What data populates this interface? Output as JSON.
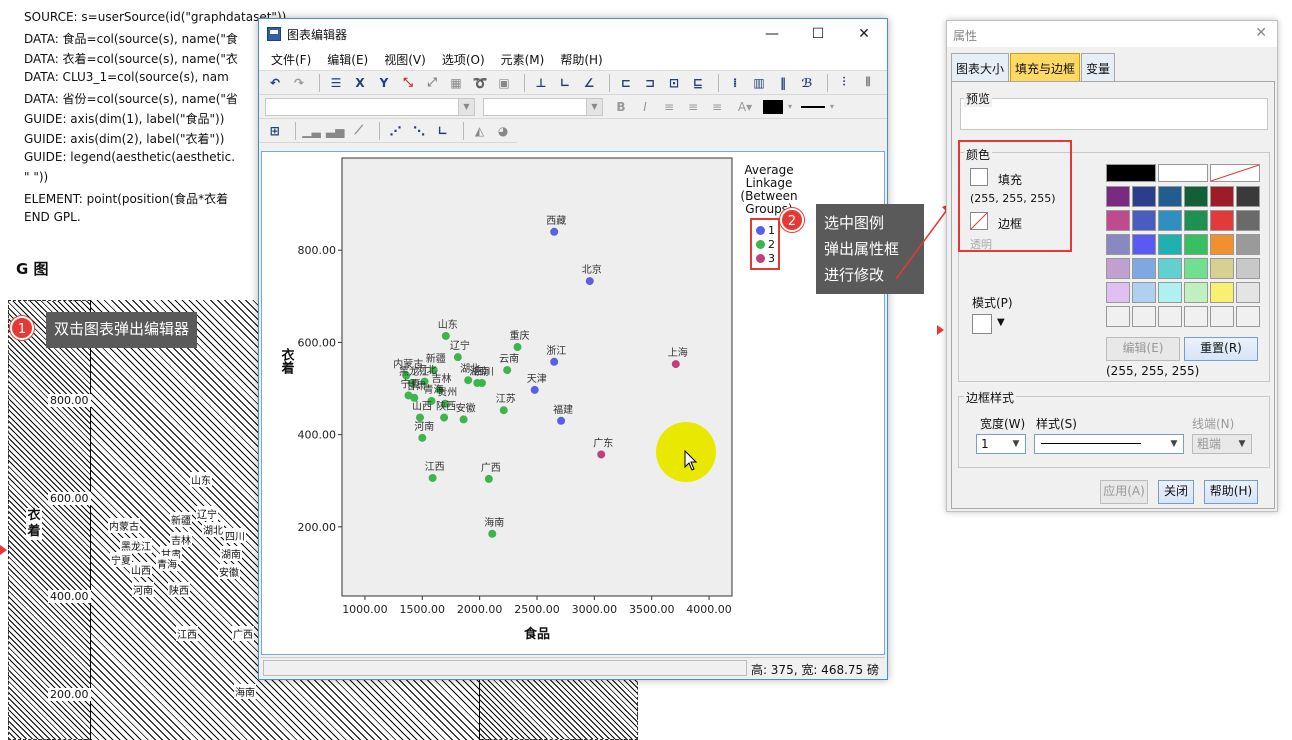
{
  "syntax": {
    "lines": [
      "SOURCE: s=userSource(id(\"graphdataset\"))",
      "DATA: 食品=col(source(s), name(\"食",
      "DATA: 衣着=col(source(s), name(\"衣",
      "DATA: CLU3_1=col(source(s), nam",
      "DATA: 省份=col(source(s), name(\"省",
      "GUIDE: axis(dim(1), label(\"食品\"))",
      "GUIDE: axis(dim(2), label(\"衣着\"))",
      "GUIDE: legend(aesthetic(aesthetic.",
      "  \"  \"))",
      "ELEMENT: point(position(食品*衣着",
      "END GPL."
    ],
    "heading": "G 图",
    "bg_ylabel": "衣着",
    "bg_ticks": [
      "800.00",
      "600.00",
      "400.00",
      "200.00"
    ],
    "bg_points": [
      "山东",
      "新疆",
      "辽宁",
      "内蒙古",
      "黑龙江",
      "湖北",
      "四川",
      "宁夏",
      "甘肃",
      "吉林",
      "湖南",
      "山西",
      "青海",
      "安徽",
      "河南",
      "陕西",
      "江西",
      "广西",
      "海南"
    ]
  },
  "callouts": {
    "c1": {
      "number": "1",
      "text": "双击图表弹出编辑器"
    },
    "c2": {
      "number": "2",
      "lines": [
        "选中图例",
        "弹出属性框",
        "进行修改"
      ]
    }
  },
  "editor": {
    "title": "图表编辑器",
    "menu": [
      "文件(F)",
      "编辑(E)",
      "视图(V)",
      "选项(O)",
      "元素(M)",
      "帮助(H)"
    ],
    "status": "高: 375, 宽: 468.75 磅"
  },
  "chart_data": {
    "type": "scatter",
    "xlabel": "食品",
    "ylabel": "衣着",
    "xlim": [
      800,
      4200
    ],
    "ylim": [
      50,
      1000
    ],
    "x_ticks": [
      "1000.00",
      "1500.00",
      "2000.00",
      "2500.00",
      "3000.00",
      "3500.00",
      "4000.00"
    ],
    "y_ticks": [
      "200.00",
      "400.00",
      "600.00",
      "800.00"
    ],
    "legend_title": [
      "Average",
      "Linkage",
      "(Between",
      "Groups)"
    ],
    "legend": [
      {
        "label": "1",
        "color": "#5b5ee6"
      },
      {
        "label": "2",
        "color": "#3cb54a"
      },
      {
        "label": "3",
        "color": "#c0407a"
      }
    ],
    "points": [
      {
        "name": "西藏",
        "x": 2650,
        "y": 840,
        "cluster": 1
      },
      {
        "name": "北京",
        "x": 2960,
        "y": 733,
        "cluster": 1
      },
      {
        "name": "上海",
        "x": 3710,
        "y": 553,
        "cluster": 3
      },
      {
        "name": "山东",
        "x": 1705,
        "y": 614,
        "cluster": 2
      },
      {
        "name": "重庆",
        "x": 2330,
        "y": 590,
        "cluster": 2
      },
      {
        "name": "浙江",
        "x": 2650,
        "y": 558,
        "cluster": 1
      },
      {
        "name": "辽宁",
        "x": 1810,
        "y": 568,
        "cluster": 2
      },
      {
        "name": "新疆",
        "x": 1600,
        "y": 540,
        "cluster": 2
      },
      {
        "name": "内蒙古",
        "x": 1360,
        "y": 528,
        "cluster": 2
      },
      {
        "name": "云南",
        "x": 2240,
        "y": 540,
        "cluster": 2
      },
      {
        "name": "湖北",
        "x": 1900,
        "y": 518,
        "cluster": 2
      },
      {
        "name": "四川",
        "x": 2020,
        "y": 512,
        "cluster": 2
      },
      {
        "name": "天津",
        "x": 2480,
        "y": 497,
        "cluster": 1
      },
      {
        "name": "黑龙江",
        "x": 1410,
        "y": 512,
        "cluster": 2
      },
      {
        "name": "河北",
        "x": 1520,
        "y": 515,
        "cluster": 2
      },
      {
        "name": "宁夏",
        "x": 1380,
        "y": 485,
        "cluster": 2
      },
      {
        "name": "吉林",
        "x": 1650,
        "y": 497,
        "cluster": 2
      },
      {
        "name": "湖南",
        "x": 1980,
        "y": 512,
        "cluster": 2
      },
      {
        "name": "甘肃",
        "x": 1430,
        "y": 480,
        "cluster": 2
      },
      {
        "name": "青海",
        "x": 1580,
        "y": 473,
        "cluster": 2
      },
      {
        "name": "贵州",
        "x": 1700,
        "y": 467,
        "cluster": 2
      },
      {
        "name": "江苏",
        "x": 2210,
        "y": 453,
        "cluster": 2
      },
      {
        "name": "福建",
        "x": 2710,
        "y": 430,
        "cluster": 1
      },
      {
        "name": "山西",
        "x": 1480,
        "y": 437,
        "cluster": 2
      },
      {
        "name": "安徽",
        "x": 1860,
        "y": 433,
        "cluster": 2
      },
      {
        "name": "陕西",
        "x": 1690,
        "y": 437,
        "cluster": 2
      },
      {
        "name": "河南",
        "x": 1500,
        "y": 393,
        "cluster": 2
      },
      {
        "name": "广东",
        "x": 3060,
        "y": 357,
        "cluster": 3
      },
      {
        "name": "江西",
        "x": 1590,
        "y": 306,
        "cluster": 2
      },
      {
        "name": "广西",
        "x": 2080,
        "y": 304,
        "cluster": 2
      },
      {
        "name": "海南",
        "x": 2110,
        "y": 185,
        "cluster": 2
      }
    ]
  },
  "props": {
    "title": "属性",
    "tabs": [
      "图表大小",
      "填充与边框",
      "变量"
    ],
    "preview_label": "预览",
    "color_label": "颜色",
    "fill_label": "填充",
    "fill_value": "(255, 255, 255)",
    "border_label": "边框",
    "transparent_label": "透明",
    "pattern_label": "模式(P)",
    "edit_button": "编辑(E)",
    "reset_button": "重置(R)",
    "rgb_readout": "(255, 255, 255)",
    "border_style_label": "边框样式",
    "width_label": "宽度(W)",
    "width_value": "1",
    "style_label": "样式(S)",
    "cap_label": "线端(N)",
    "cap_value": "粗端",
    "apply_button": "应用(A)",
    "close_button": "关闭",
    "help_button": "帮助(H)",
    "swatches": [
      "#7b2a82",
      "#2a3f8c",
      "#215e8f",
      "#12603a",
      "#9e1c26",
      "#3a3a3a",
      "#c04a8e",
      "#4a5cc0",
      "#2f8fc0",
      "#1e9050",
      "#e03a3a",
      "#6a6a6a",
      "#8a88c0",
      "#5a5af0",
      "#20b0b0",
      "#38c060",
      "#f09030",
      "#9a9a9a",
      "#c0a0d0",
      "#80a8e0",
      "#60d0d0",
      "#70e090",
      "#d8d090",
      "#c8c8c8",
      "#e0c0f0",
      "#b0d0f0",
      "#b0f0f0",
      "#c0f0c0",
      "#f8f070",
      "#e4e4e4",
      "#f0f0f0",
      "#f0f0f0",
      "#f0f0f0",
      "#f0f0f0",
      "#f0f0f0",
      "#f0f0f0"
    ]
  }
}
